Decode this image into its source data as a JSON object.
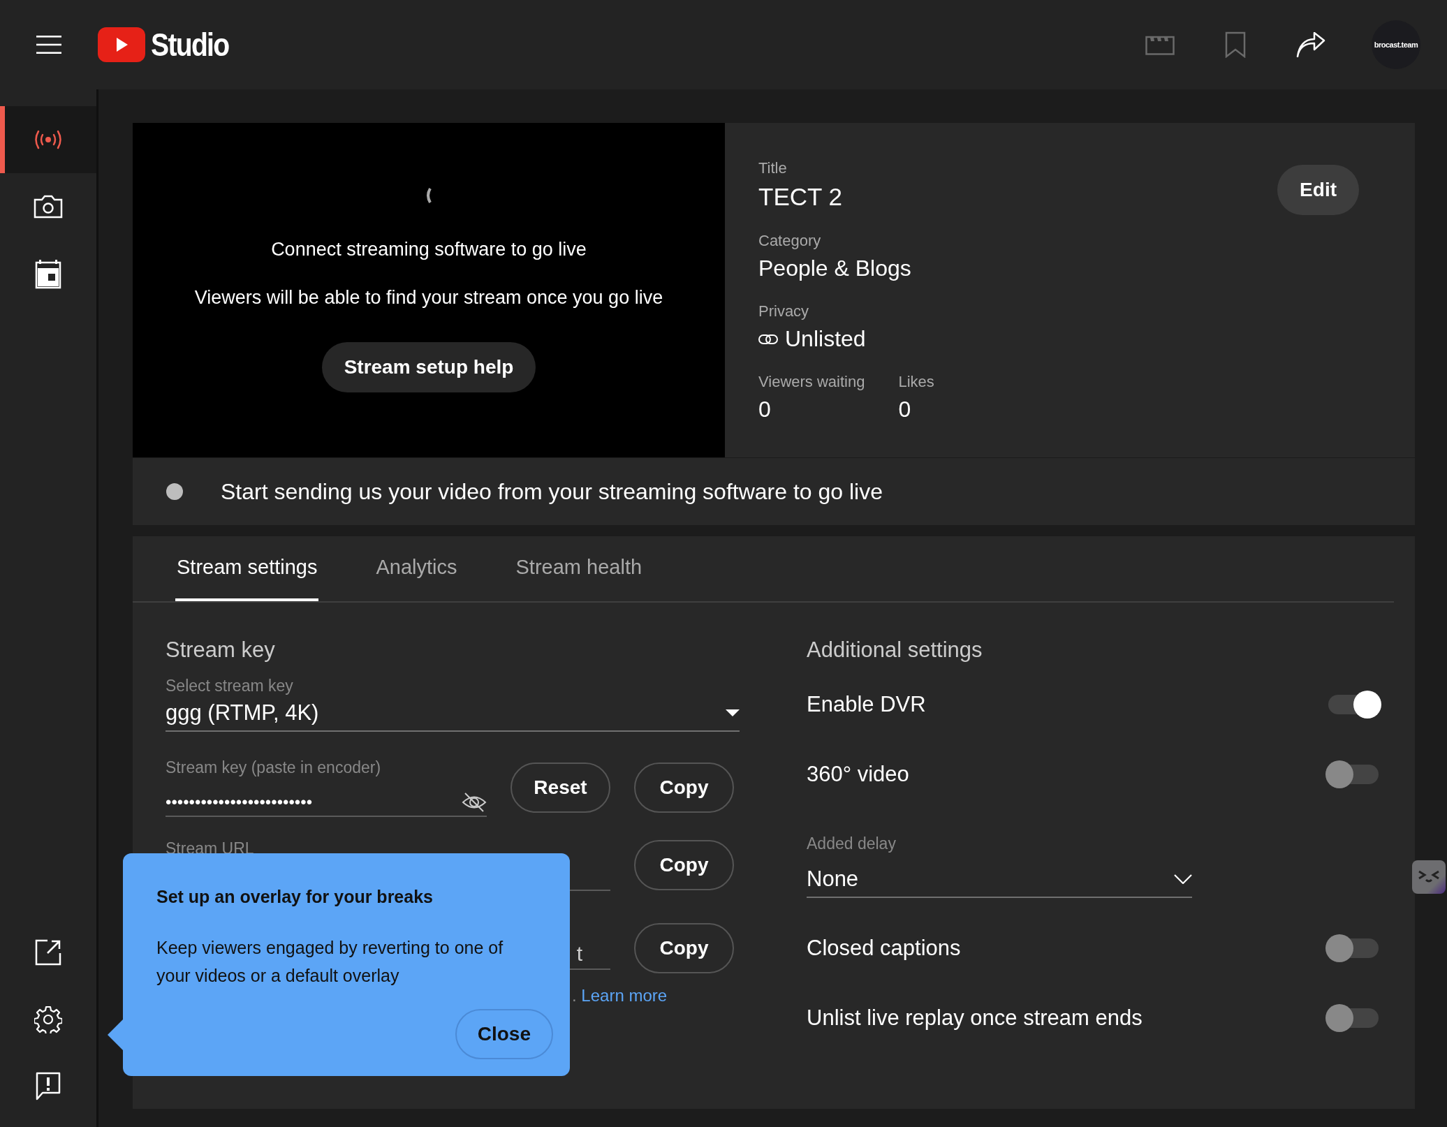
{
  "header": {
    "logo_text": "Studio",
    "avatar_text": "brocast.team"
  },
  "sidebar": {
    "items": [
      {
        "kind": "live",
        "selected": true
      },
      {
        "kind": "camera",
        "selected": false
      },
      {
        "kind": "calendar",
        "selected": false
      }
    ],
    "bottom_items": [
      {
        "kind": "external"
      },
      {
        "kind": "settings"
      },
      {
        "kind": "feedback"
      }
    ]
  },
  "preview": {
    "message": "Connect streaming software to go live",
    "submessage": "Viewers will be able to find your stream once you go live",
    "button": "Stream setup help"
  },
  "details": {
    "title_label": "Title",
    "title": "TECT 2",
    "edit_button": "Edit",
    "category_label": "Category",
    "category": "People & Blogs",
    "privacy_label": "Privacy",
    "privacy": "Unlisted",
    "stats": [
      {
        "label": "Viewers waiting",
        "value": "0"
      },
      {
        "label": "Likes",
        "value": "0"
      }
    ]
  },
  "status": {
    "message": "Start sending us your video from your streaming software to go live"
  },
  "tabs": [
    {
      "label": "Stream settings",
      "selected": true
    },
    {
      "label": "Analytics",
      "selected": false
    },
    {
      "label": "Stream health",
      "selected": false
    }
  ],
  "stream_key": {
    "heading": "Stream key",
    "select_label": "Select stream key",
    "select_value": "ggg (RTMP, 4K)",
    "key_label": "Stream key (paste in encoder)",
    "key_value": "•••••••••••••••••••••••••",
    "reset_button": "Reset",
    "copy_buttons": [
      "Copy",
      "Copy",
      "Copy"
    ],
    "url_label": "Stream URL",
    "backup_value": "t",
    "note_tail": ".",
    "learn_more": "Learn more"
  },
  "additional": {
    "heading": "Additional settings",
    "items": [
      {
        "kind": "toggle",
        "label": "Enable DVR",
        "on": true
      },
      {
        "kind": "toggle",
        "label": "360° video",
        "on": false
      },
      {
        "kind": "select",
        "label": "Added delay",
        "value": "None"
      },
      {
        "kind": "toggle",
        "label": "Closed captions",
        "on": false
      },
      {
        "kind": "toggle",
        "label": "Unlist live replay once stream ends",
        "on": false
      }
    ]
  },
  "tooltip": {
    "title": "Set up an overlay for your breaks",
    "body": "Keep viewers engaged by reverting to one of your videos or a default overlay",
    "button": "Close"
  }
}
